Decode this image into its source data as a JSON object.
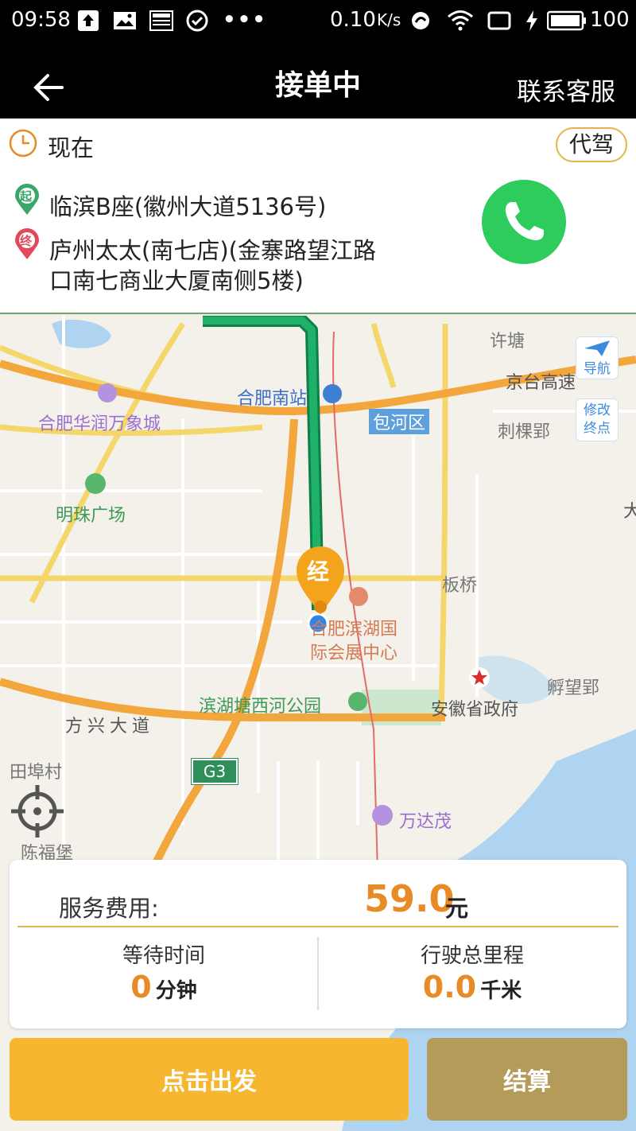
{
  "status_bar": {
    "time": "09:58",
    "net_speed": "0.10",
    "net_unit": "K/s",
    "battery": "100",
    "icons": [
      "upload-icon",
      "image-icon",
      "news-icon",
      "check-circle-icon",
      "more-dots-icon",
      "nfc-icon",
      "wifi-icon",
      "screen-icon",
      "charging-icon",
      "battery-icon"
    ]
  },
  "header": {
    "title": "接单中",
    "back_icon": "arrow-left-icon",
    "right_action": "联系客服"
  },
  "order": {
    "time_label": "现在",
    "service_tag": "代驾",
    "start_badge": "起",
    "start_address": "临滨B座(徽州大道5136号)",
    "end_badge": "终",
    "end_address_line1": "庐州太太(南七店)(金寨路望江路",
    "end_address_line2": "口南七商业大厦南侧5楼)",
    "phone_icon": "phone-icon"
  },
  "map": {
    "labels": {
      "xutang": "许塘",
      "hefei_south": "合肥南站",
      "jingtai": "京台高速",
      "baohe": "包河区",
      "cilidang": "刺棵郢",
      "huarun": "合肥华润万象城",
      "mingzhu": "明珠广场",
      "banqiao": "板桥",
      "expo_line1": "合肥滨湖国",
      "expo_line2": "际会展中心",
      "fuwangying": "孵望郢",
      "bintang": "滨湖塘西河公园",
      "gov": "安徽省政府",
      "fangxing": "方兴大道",
      "tianbu": "田埠村",
      "g3": "G3",
      "wanda": "万达茂",
      "chenfu": "陈福堡",
      "da": "大",
      "jingjing": "经"
    },
    "nav_button": "导航",
    "change_dest_line1": "修改",
    "change_dest_line2": "终点",
    "locate_icon": "crosshair-icon"
  },
  "fees": {
    "service_fee_label": "服务费用:",
    "service_fee_value": "59.0",
    "service_fee_unit": "元",
    "wait_label": "等待时间",
    "wait_value": "0",
    "wait_unit": "分钟",
    "distance_label": "行驶总里程",
    "distance_value": "0.0",
    "distance_unit": "千米"
  },
  "actions": {
    "depart": "点击出发",
    "settle": "结算"
  },
  "colors": {
    "accent_orange": "#e88a25",
    "depart_button": "#f7b62f",
    "settle_button": "#b59b59",
    "phone_green": "#2ecc5c",
    "route_green": "#1a9a5a"
  }
}
